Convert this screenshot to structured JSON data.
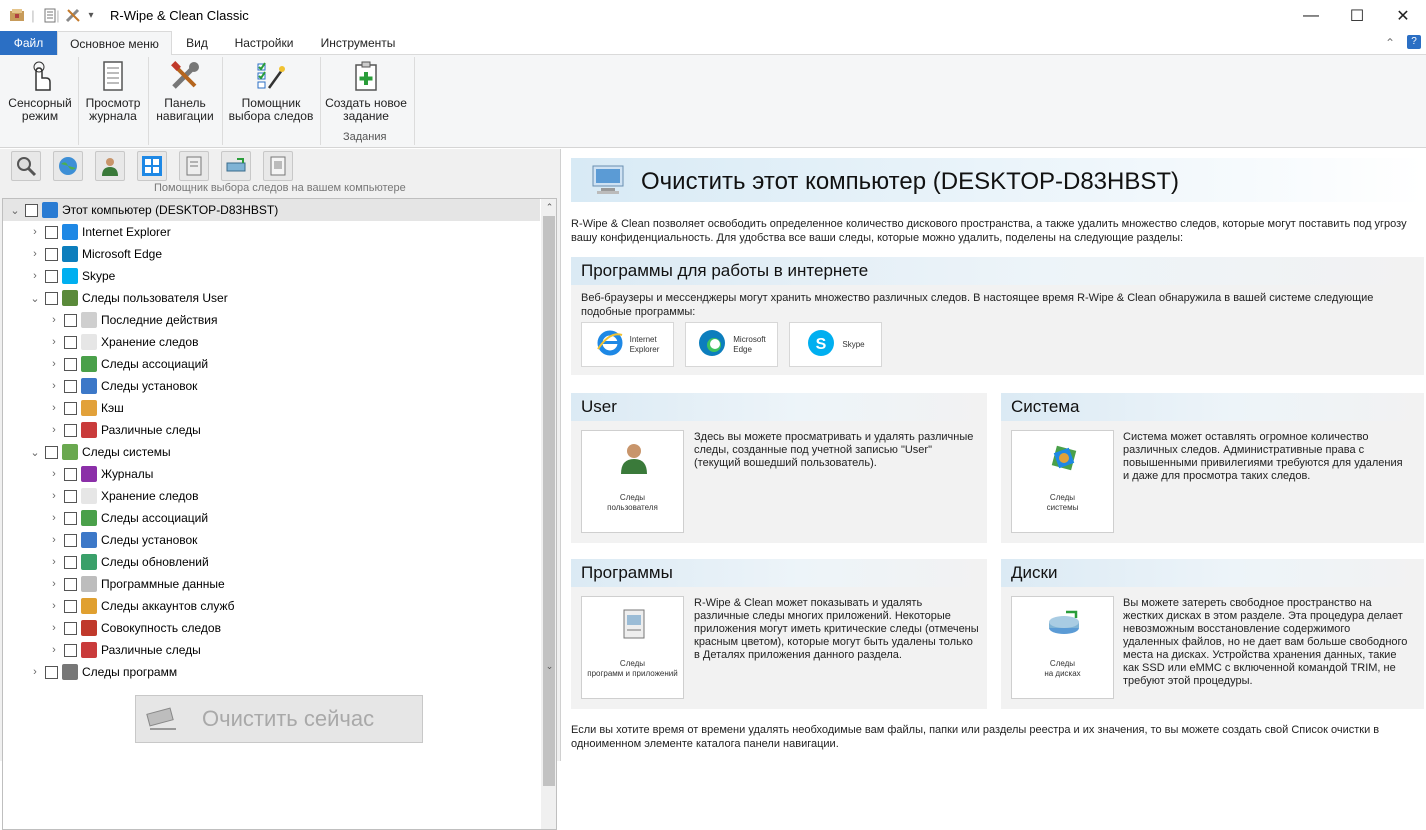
{
  "window": {
    "title": "R-Wipe & Clean Classic",
    "controls": {
      "minimize": "—",
      "maximize": "☐",
      "close": "✕"
    }
  },
  "menu": {
    "file": "Файл",
    "tabs": [
      "Основное меню",
      "Вид",
      "Настройки",
      "Инструменты"
    ],
    "active": "Основное меню"
  },
  "ribbon": {
    "buttons": [
      {
        "l1": "Сенсорный",
        "l2": "режим",
        "icon": "hand-touch-icon"
      },
      {
        "l1": "Просмотр",
        "l2": "журнала",
        "icon": "log-icon"
      },
      {
        "l1": "Панель",
        "l2": "навигации",
        "icon": "tools-icon"
      },
      {
        "l1": "Помощник",
        "l2": "выбора следов",
        "icon": "checklist-wand-icon"
      },
      {
        "l1": "Создать новое",
        "l2": "задание",
        "icon": "new-task-icon"
      }
    ],
    "group_label": "Задания"
  },
  "left": {
    "toolbar_caption": "Помощник выбора следов на вашем компьютере",
    "tree": [
      {
        "label": "Этот компьютер  (DESKTOP-D83HBST)",
        "level": 0,
        "exp": "v",
        "icon": "#2b7cd3",
        "sel": true
      },
      {
        "label": "Internet  Explorer",
        "level": 1,
        "exp": ">",
        "icon": "#1e88e5"
      },
      {
        "label": "Microsoft Edge",
        "level": 1,
        "exp": ">",
        "icon": "#0c7ebd"
      },
      {
        "label": "Skype",
        "level": 1,
        "exp": ">",
        "icon": "#00aff0"
      },
      {
        "label": "Следы пользователя User",
        "level": 1,
        "exp": "v",
        "icon": "#5a8a3a"
      },
      {
        "label": "Последние действия",
        "level": 2,
        "exp": ">",
        "icon": "#cfcfcf"
      },
      {
        "label": "Хранение следов",
        "level": 2,
        "exp": ">",
        "icon": "#e6e6e6"
      },
      {
        "label": "Следы ассоциаций",
        "level": 2,
        "exp": ">",
        "icon": "#4aa04a"
      },
      {
        "label": "Следы установок",
        "level": 2,
        "exp": ">",
        "icon": "#3c78c8"
      },
      {
        "label": "Кэш",
        "level": 2,
        "exp": ">",
        "icon": "#e2a13a"
      },
      {
        "label": "Различные следы",
        "level": 2,
        "exp": ">",
        "icon": "#c93b3b"
      },
      {
        "label": "Следы системы",
        "level": 1,
        "exp": "v",
        "icon": "#6aa84f"
      },
      {
        "label": "Журналы",
        "level": 2,
        "exp": ">",
        "icon": "#8b2fa8"
      },
      {
        "label": "Хранение следов",
        "level": 2,
        "exp": ">",
        "icon": "#e6e6e6"
      },
      {
        "label": "Следы ассоциаций",
        "level": 2,
        "exp": ">",
        "icon": "#4aa04a"
      },
      {
        "label": "Следы установок",
        "level": 2,
        "exp": ">",
        "icon": "#3c78c8"
      },
      {
        "label": "Следы обновлений",
        "level": 2,
        "exp": ">",
        "icon": "#3aa06a"
      },
      {
        "label": "Программные данные",
        "level": 2,
        "exp": ">",
        "icon": "#bdbdbd"
      },
      {
        "label": "Следы аккаунтов служб",
        "level": 2,
        "exp": ">",
        "icon": "#e0a030"
      },
      {
        "label": "Совокупность следов",
        "level": 2,
        "exp": ">",
        "icon": "#c0392b"
      },
      {
        "label": "Различные следы",
        "level": 2,
        "exp": ">",
        "icon": "#c93b3b"
      },
      {
        "label": "Следы программ",
        "level": 1,
        "exp": ">",
        "icon": "#777777"
      }
    ],
    "clean_button": "Очистить сейчас"
  },
  "right": {
    "title": "Очистить этот компьютер  (DESKTOP-D83HBST)",
    "intro": "R-Wipe & Clean позволяет освободить определенное количество дискового пространства, а также удалить множество следов, которые могут поставить под угрозу вашу конфиденциальность. Для удобства все ваши следы, которые можно удалить, поделены на следующие разделы:",
    "internet": {
      "title": "Программы для работы в интернете",
      "desc": "Веб-браузеры и мессенджеры могут хранить множество различных следов. В настоящее время R-Wipe & Clean обнаружила в вашей системе следующие подобные программы:",
      "apps": [
        {
          "l1": "Internet",
          "l2": "Explorer"
        },
        {
          "l1": "Microsoft",
          "l2": "Edge"
        },
        {
          "l1": "Skype",
          "l2": ""
        }
      ]
    },
    "user": {
      "title": "User",
      "tile_l1": "Следы",
      "tile_l2": "пользователя",
      "desc": "Здесь вы можете просматривать и удалять различные следы, созданные под учетной записью \"User\" (текущий вошедший пользователь)."
    },
    "system": {
      "title": "Система",
      "tile_l1": "Следы",
      "tile_l2": "системы",
      "desc": "Система может оставлять огромное количество различных следов. Административные права с повышенными привилегиями требуются для удаления и даже для просмотра таких следов."
    },
    "programs": {
      "title": "Программы",
      "tile_l1": "Следы",
      "tile_l2": "программ и приложений",
      "desc": "R-Wipe & Clean может показывать и удалять различные следы многих приложений. Некоторые приложения могут иметь критические следы (отмечены красным цветом), которые могут быть удалены только в Деталях приложения данного раздела."
    },
    "disks": {
      "title": "Диски",
      "tile_l1": "Следы",
      "tile_l2": "на дисках",
      "desc": "Вы можете затереть свободное пространство на жестких дисках в этом разделе. Эта процедура делает невозможным восстановление содержимого удаленных файлов, но не дает вам больше свободного места на дисках. Устройства хранения данных, такие как SSD или eMMC с включенной командой TRIM, не требуют этой процедуры."
    },
    "footer": "Если вы хотите время от времени удалять необходимые вам файлы, папки или разделы реестра и их значения, то вы можете создать свой Список очистки в одноименном элементе каталога  панели навигации."
  }
}
